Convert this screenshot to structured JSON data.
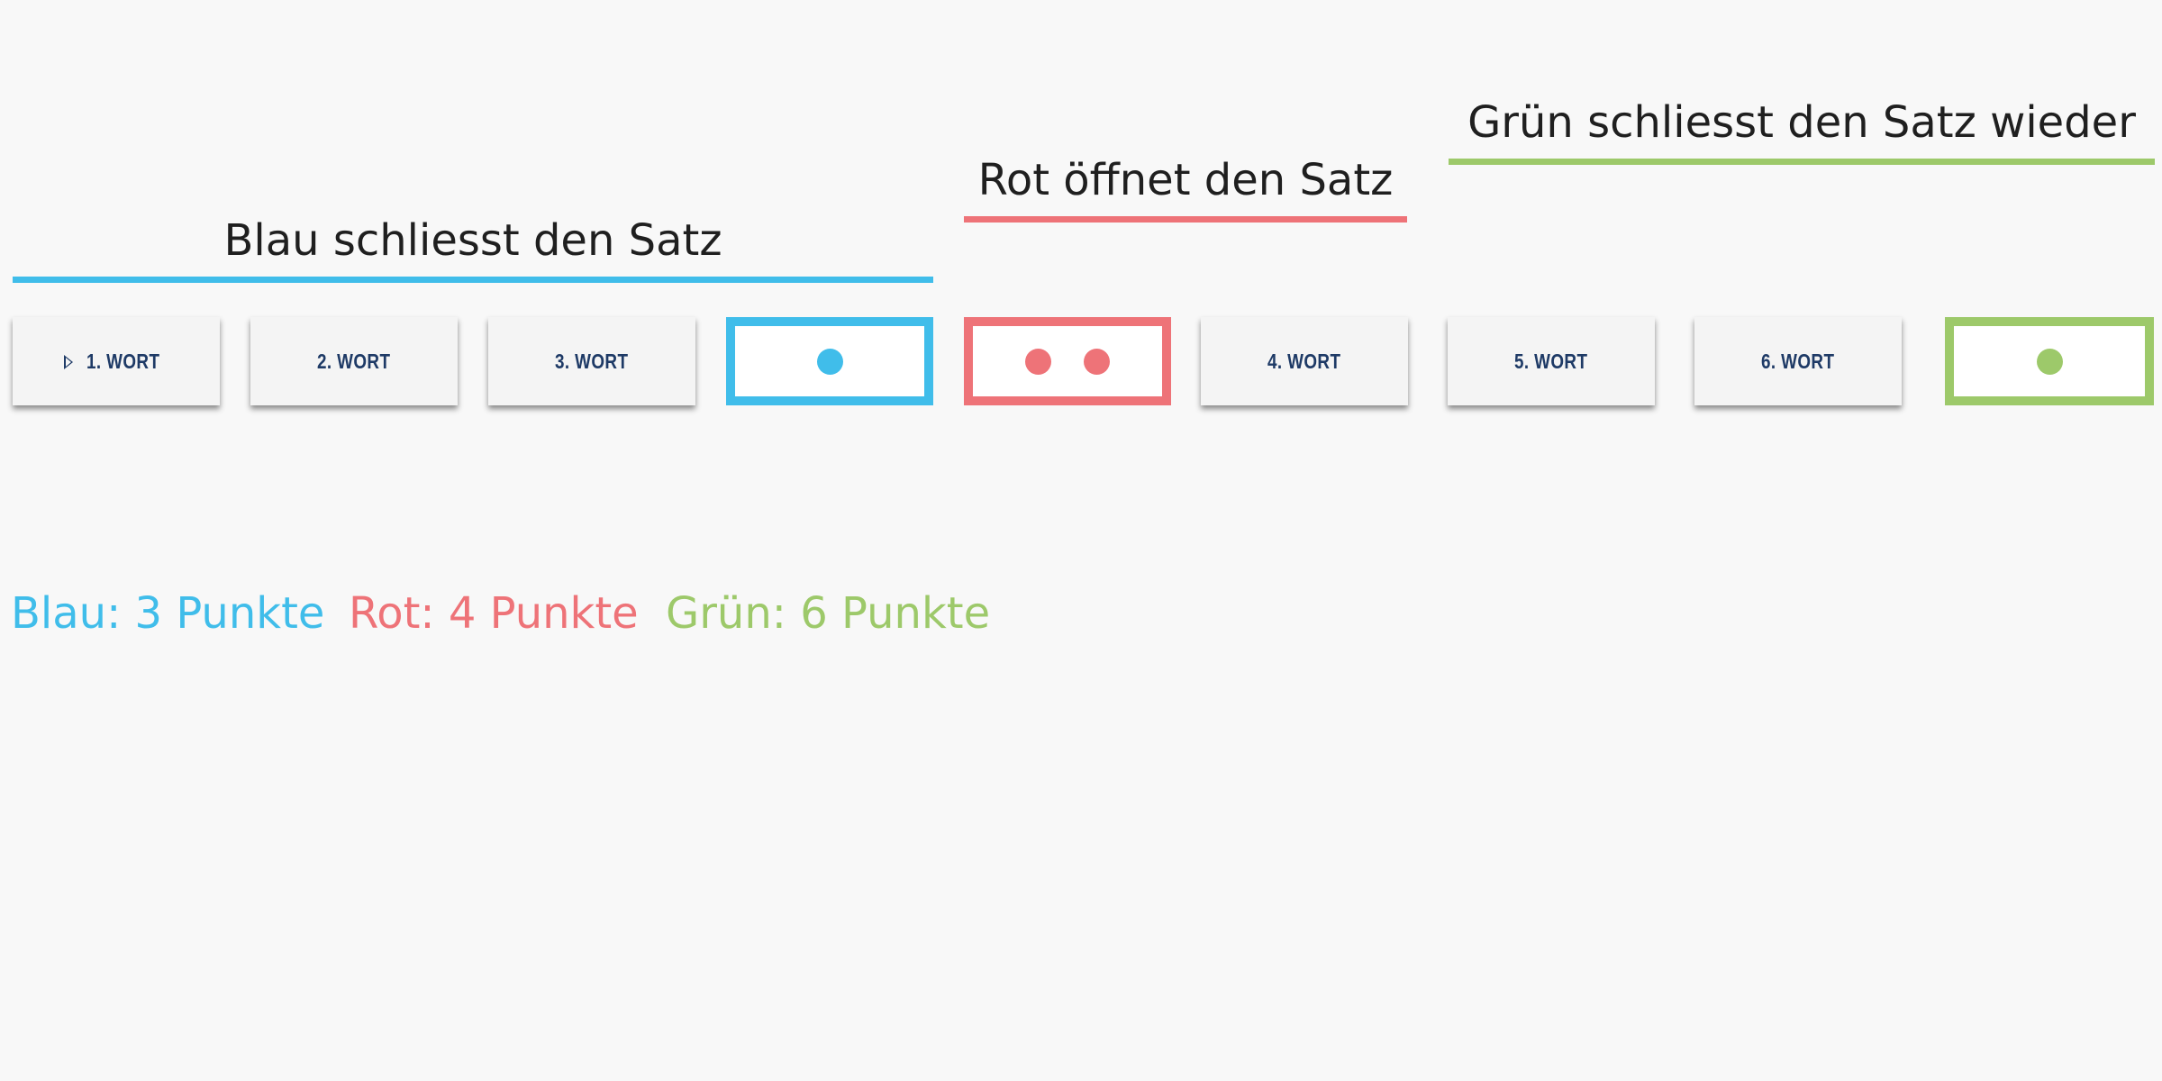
{
  "labels": {
    "blau": "Blau schliesst den Satz",
    "rot": "Rot öffnet den Satz",
    "gruen": "Grün schliesst den Satz wieder"
  },
  "cards": {
    "w1": "1. WORT",
    "w2": "2. WORT",
    "w3": "3. WORT",
    "w4": "4. WORT",
    "w5": "5. WORT",
    "w6": "6. WORT"
  },
  "marks": {
    "blue_dots": 1,
    "red_dots": 2,
    "green_dots": 1
  },
  "legend": {
    "blau": "Blau: 3 Punkte",
    "rot": "Rot: 4 Punkte",
    "gruen": "Grün: 6 Punkte"
  },
  "colors": {
    "blue": "#40bdea",
    "red": "#ee7378",
    "green": "#9dc96a",
    "text": "#1f1f1f",
    "card_text": "#1e3a66"
  },
  "icons": {
    "first_card": "play-icon"
  }
}
